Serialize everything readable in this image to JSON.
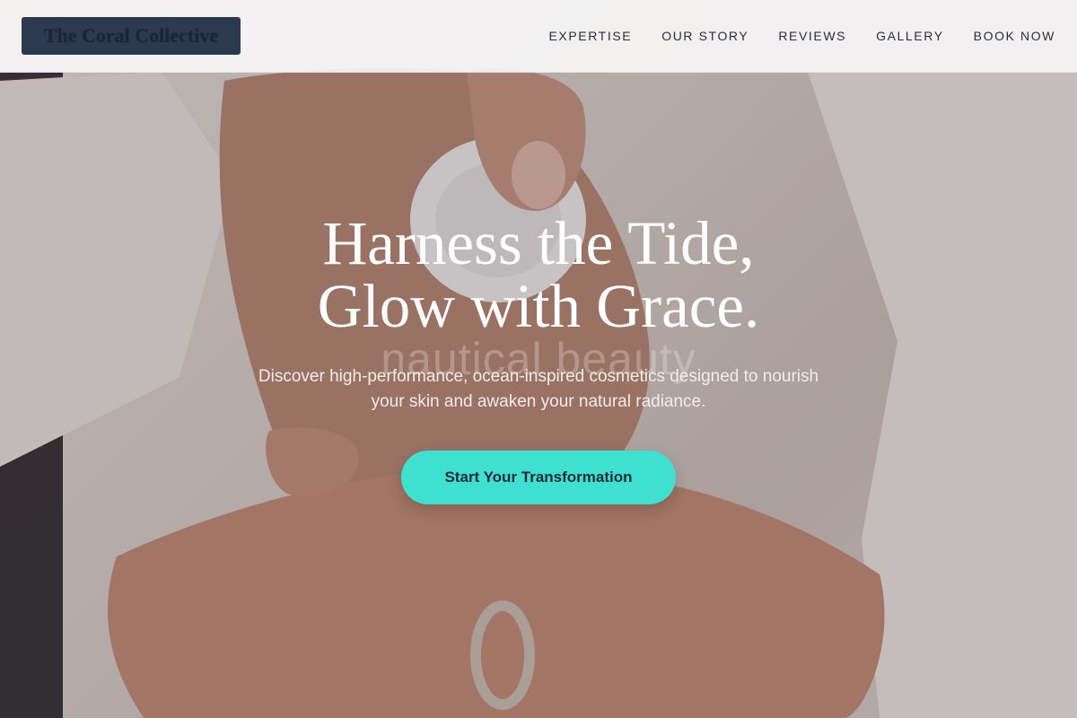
{
  "header": {
    "logo_text": "The Coral Collective",
    "nav": [
      {
        "label": "EXPERTISE"
      },
      {
        "label": "OUR STORY"
      },
      {
        "label": "REVIEWS"
      },
      {
        "label": "GALLERY"
      },
      {
        "label": "BOOK NOW"
      }
    ]
  },
  "hero": {
    "title_line_1": "Harness the Tide,",
    "title_line_2": "Glow with Grace.",
    "watermark": "nautical beauty",
    "subtitle": "Discover high-performance, ocean-inspired cosmetics designed to nourish your skin and awaken your natural radiance.",
    "cta_label": "Start Your Transformation"
  },
  "colors": {
    "accent": "#40e0d0",
    "logo_bg": "#2c3a50",
    "header_bg": "#f7f6f6"
  }
}
